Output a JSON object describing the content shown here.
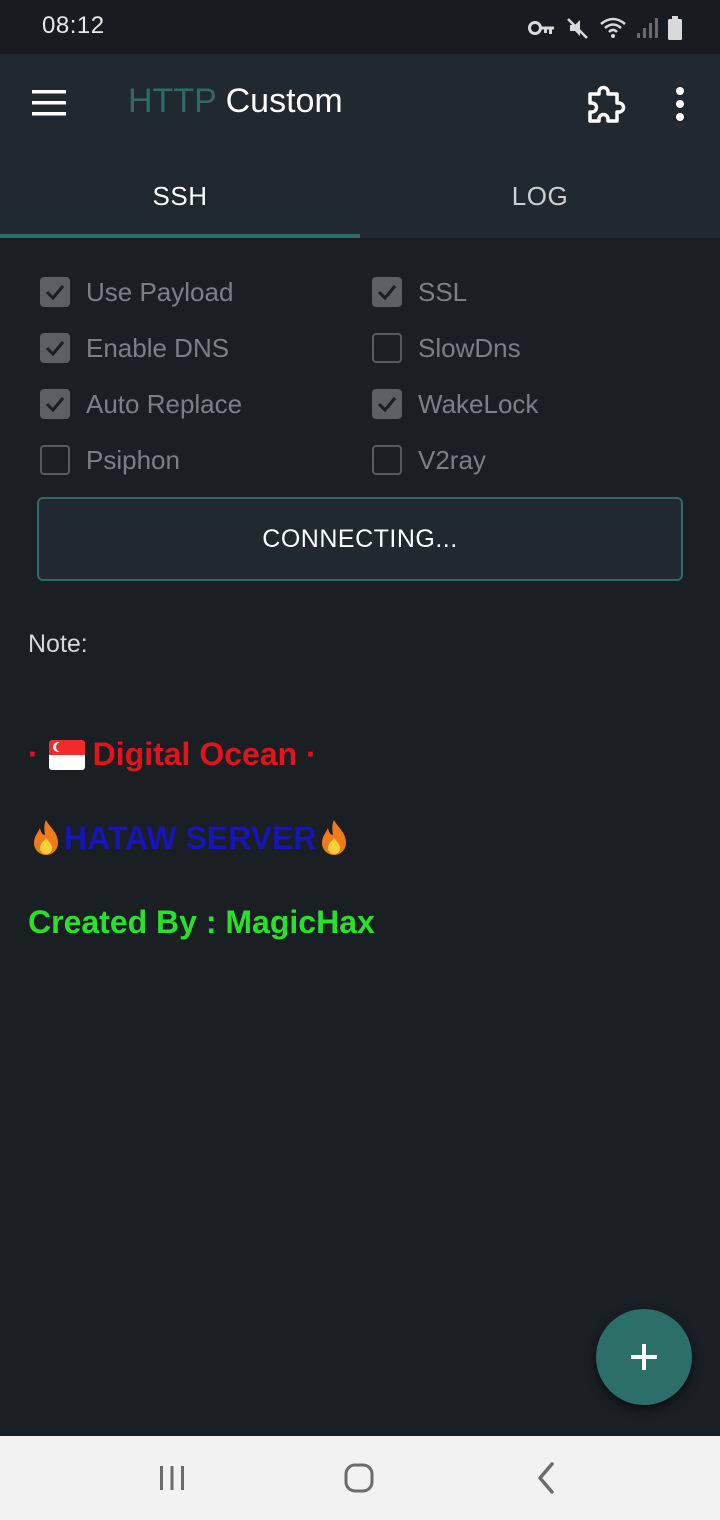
{
  "status_bar": {
    "time": "08:12",
    "icons": [
      "vpn-key-icon",
      "mute-icon",
      "wifi-icon",
      "signal-icon",
      "battery-icon"
    ]
  },
  "app_bar": {
    "title_accent": "HTTP",
    "title_main": " Custom",
    "icons": [
      "menu-icon",
      "plugin-icon",
      "more-vert-icon"
    ]
  },
  "tabs": [
    {
      "label": "SSH",
      "selected": true
    },
    {
      "label": "LOG",
      "selected": false
    }
  ],
  "options": [
    {
      "label": "Use Payload",
      "checked": true
    },
    {
      "label": "SSL",
      "checked": true
    },
    {
      "label": "Enable DNS",
      "checked": true
    },
    {
      "label": "SlowDns",
      "checked": false
    },
    {
      "label": "Auto Replace",
      "checked": true
    },
    {
      "label": "WakeLock",
      "checked": true
    },
    {
      "label": "Psiphon",
      "checked": false
    },
    {
      "label": "V2ray",
      "checked": false
    }
  ],
  "connect_button": {
    "label": "CONNECTING..."
  },
  "note": {
    "label": "Note:",
    "line1_prefix": "·",
    "line1_text": "Digital Ocean ·",
    "line2_text": "HATAW SERVER",
    "line3_text": "Created By : MagicHax"
  },
  "colors": {
    "accent": "#2e6b66",
    "background": "#1a1f24",
    "appbar": "#202830",
    "note_red": "#e0141b",
    "note_blue": "#1515b8",
    "note_green": "#2be02b"
  },
  "fab": {
    "icon": "plus-icon"
  },
  "nav_bar": {
    "icons": [
      "recents-icon",
      "home-icon",
      "back-icon"
    ]
  }
}
